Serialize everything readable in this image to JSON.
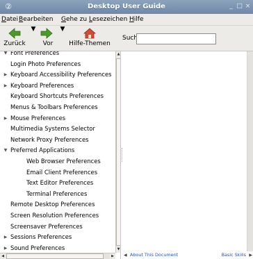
{
  "window": {
    "title": "Desktop User Guide",
    "controls": {
      "minimize": "_",
      "maximize": "□",
      "close": "×"
    }
  },
  "menu": [
    "Datei",
    "Bearbeiten",
    "Gehe zu",
    "Lesezeichen",
    "Hilfe"
  ],
  "toolbar": {
    "back_label": "Zurück",
    "forward_label": "Vor",
    "home_label": "Hilfe-Themen",
    "search_label": "Suchen:",
    "search_value": ""
  },
  "tree": [
    {
      "label": "Font Preferences",
      "level": 0,
      "expander": "open"
    },
    {
      "label": "Login Photo Preferences",
      "level": 0,
      "expander": "none"
    },
    {
      "label": "Keyboard Accessibility Preferences",
      "level": 0,
      "expander": "closed"
    },
    {
      "label": "Keyboard Preferences",
      "level": 0,
      "expander": "closed"
    },
    {
      "label": "Keyboard Shortcuts Preferences",
      "level": 0,
      "expander": "none"
    },
    {
      "label": "Menus & Toolbars Preferences",
      "level": 0,
      "expander": "none"
    },
    {
      "label": "Mouse Preferences",
      "level": 0,
      "expander": "closed"
    },
    {
      "label": "Multimedia Systems Selector",
      "level": 0,
      "expander": "none"
    },
    {
      "label": "Network Proxy Preferences",
      "level": 0,
      "expander": "none"
    },
    {
      "label": "Preferred Applications",
      "level": 0,
      "expander": "open"
    },
    {
      "label": "Web Browser Preferences",
      "level": 1,
      "expander": "none"
    },
    {
      "label": "Email Client Preferences",
      "level": 1,
      "expander": "none"
    },
    {
      "label": "Text Editor Preferences",
      "level": 1,
      "expander": "none"
    },
    {
      "label": "Terminal Preferences",
      "level": 1,
      "expander": "none"
    },
    {
      "label": "Remote Desktop Preferences",
      "level": 0,
      "expander": "none"
    },
    {
      "label": "Screen Resolution Preferences",
      "level": 0,
      "expander": "none"
    },
    {
      "label": "Screensaver Preferences",
      "level": 0,
      "expander": "none"
    },
    {
      "label": "Sessions Preferences",
      "level": 0,
      "expander": "closed"
    },
    {
      "label": "Sound Preferences",
      "level": 0,
      "expander": "closed"
    }
  ],
  "footer": {
    "prev_label": "About This Document",
    "next_label": "Basic Skills"
  },
  "colors": {
    "titlebar": "#7d95b3",
    "link": "#2a4fb5",
    "chrome": "#ecebe8"
  }
}
